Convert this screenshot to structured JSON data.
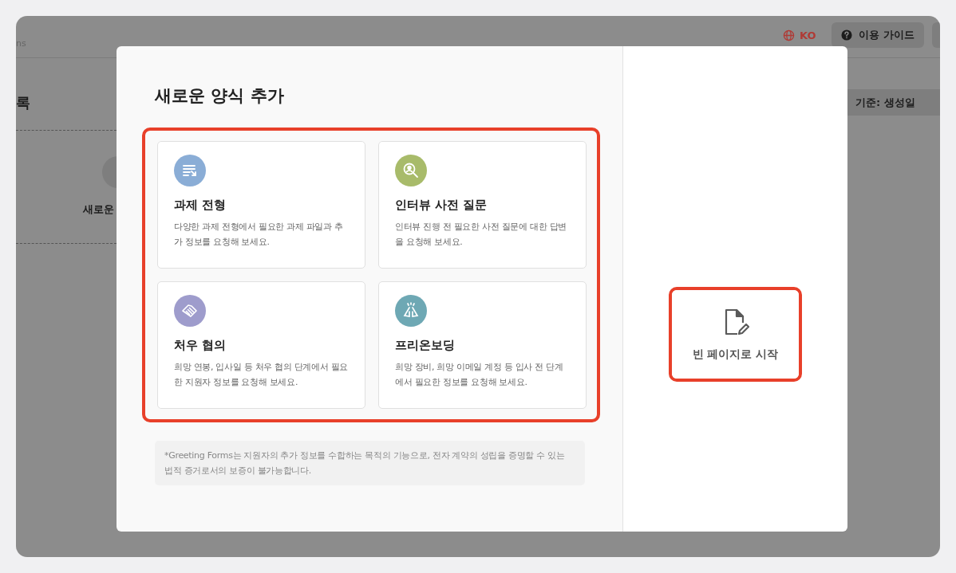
{
  "background": {
    "header_text": "ns",
    "language": "KO",
    "guide_button": "이용 가이드",
    "heading": "록",
    "new_item": "새로운",
    "sort_button": "기준: 생성일"
  },
  "modal": {
    "title": "새로운 양식 추가",
    "templates": [
      {
        "kind": "assignment",
        "color": "#8aadd6",
        "title": "과제 전형",
        "description": "다양한 과제 전형에서 필요한 과제 파일과 추가 정보를 요청해 보세요."
      },
      {
        "kind": "interview",
        "color": "#a8bb6a",
        "title": "인터뷰 사전 질문",
        "description": "인터뷰 진행 전 필요한 사전 질문에 대한 답변을 요청해 보세요."
      },
      {
        "kind": "negotiation",
        "color": "#9e9ccc",
        "title": "처우 협의",
        "description": "희망 연봉, 입사일 등 처우 협의 단계에서 필요한 지원자 정보를 요청해 보세요."
      },
      {
        "kind": "onboarding",
        "color": "#6ea8b4",
        "title": "프리온보딩",
        "description": "희망 장비, 희망 이메일 계정 등 입사 전 단계에서 필요한 정보를 요청해 보세요."
      }
    ],
    "note": "*Greeting Forms는 지원자의 추가 정보를 수합하는 목적의 기능으로, 전자 계약의 성립을 증명할 수 있는 법적 증거로서의 보증이 불가능합니다.",
    "blank_page": "빈 페이지로 시작"
  }
}
